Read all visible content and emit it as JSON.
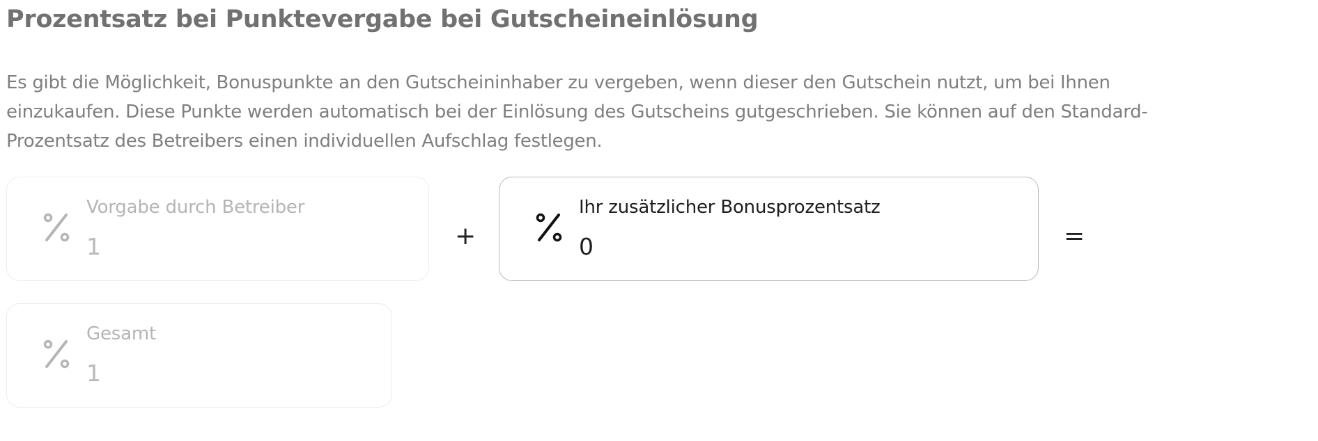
{
  "section": {
    "title": "Prozentsatz bei Punktevergabe bei Gutscheineinlösung",
    "description_lines": [
      "Es gibt die Möglichkeit, Bonuspunkte an den Gutscheininhaber zu vergeben, wenn dieser den Gutschein nutzt, um bei Ihnen",
      "einzukaufen. Diese Punkte werden automatisch bei der Einlösung des Gutscheins gutgeschrieben. Sie können auf den Standard-",
      "Prozentsatz des Betreibers einen individuellen Aufschlag festlegen."
    ]
  },
  "fields": {
    "operator": {
      "label": "Vorgabe durch Betreiber",
      "value": "1",
      "icon": "percent-icon",
      "disabled": true
    },
    "bonus": {
      "label": "Ihr zusätzlicher Bonusprozentsatz",
      "value": "0",
      "icon": "percent-icon",
      "disabled": false
    },
    "total": {
      "label": "Gesamt",
      "value": "1",
      "icon": "percent-icon",
      "disabled": true
    }
  },
  "operators": {
    "plus": "+",
    "equals": "="
  },
  "colors": {
    "title": "#717171",
    "text": "#7f7f7f",
    "disabled_text": "#b5b5b5",
    "active_text": "#1e1e1e",
    "active_border": "#b9b9b9",
    "disabled_border": "#ececec"
  }
}
